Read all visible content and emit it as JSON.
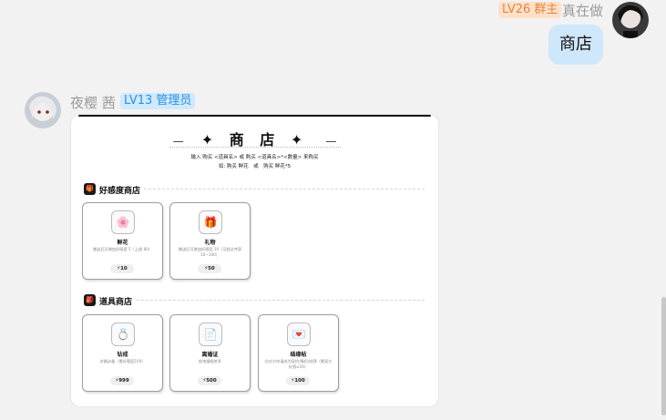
{
  "chat": {
    "msg1": {
      "level_badge": "LV26 群主",
      "sender": "真在做",
      "text": "商店"
    },
    "msg2": {
      "sender": "夜樱 茜",
      "level_badge": "LV13 管理员"
    }
  },
  "shop": {
    "title": "✦ 商 店 ✦",
    "dash": "—",
    "usage_line1": "输入 购买 <道具名> 或 购买 <道具名>*<数量> 来购买",
    "usage_line2": "如: 购买 鲜花　或　购买 鲜花*5",
    "sections": [
      {
        "icon": "gift-icon",
        "title": "好感度商店",
        "items": [
          {
            "icon": "flower-icon",
            "glyph": "🌸",
            "name": "鲜花",
            "desc": "赠送后可增加好感度 5（上限 80）",
            "price": "⚡10"
          },
          {
            "icon": "gift-icon",
            "glyph": "🎁",
            "name": "礼物",
            "desc": "赠送后可增加好感度 10（可超过并获10~100）",
            "price": "⚡50"
          }
        ]
      },
      {
        "icon": "bag-icon",
        "title": "道具商店",
        "items": [
          {
            "icon": "ring-icon",
            "glyph": "💍",
            "name": "钻戒",
            "desc": "求婚必备（需好感度100）",
            "price": "⚡999"
          },
          {
            "icon": "document-icon",
            "glyph": "📄",
            "name": "离婚证",
            "desc": "结束婚姻关系",
            "price": "⚡500"
          },
          {
            "icon": "love-letter-icon",
            "glyph": "💌",
            "name": "结缘帖",
            "desc": "向对方申请成为契约/情侣/结拜（需双方好感≥50）",
            "price": "⚡100"
          }
        ]
      }
    ]
  }
}
